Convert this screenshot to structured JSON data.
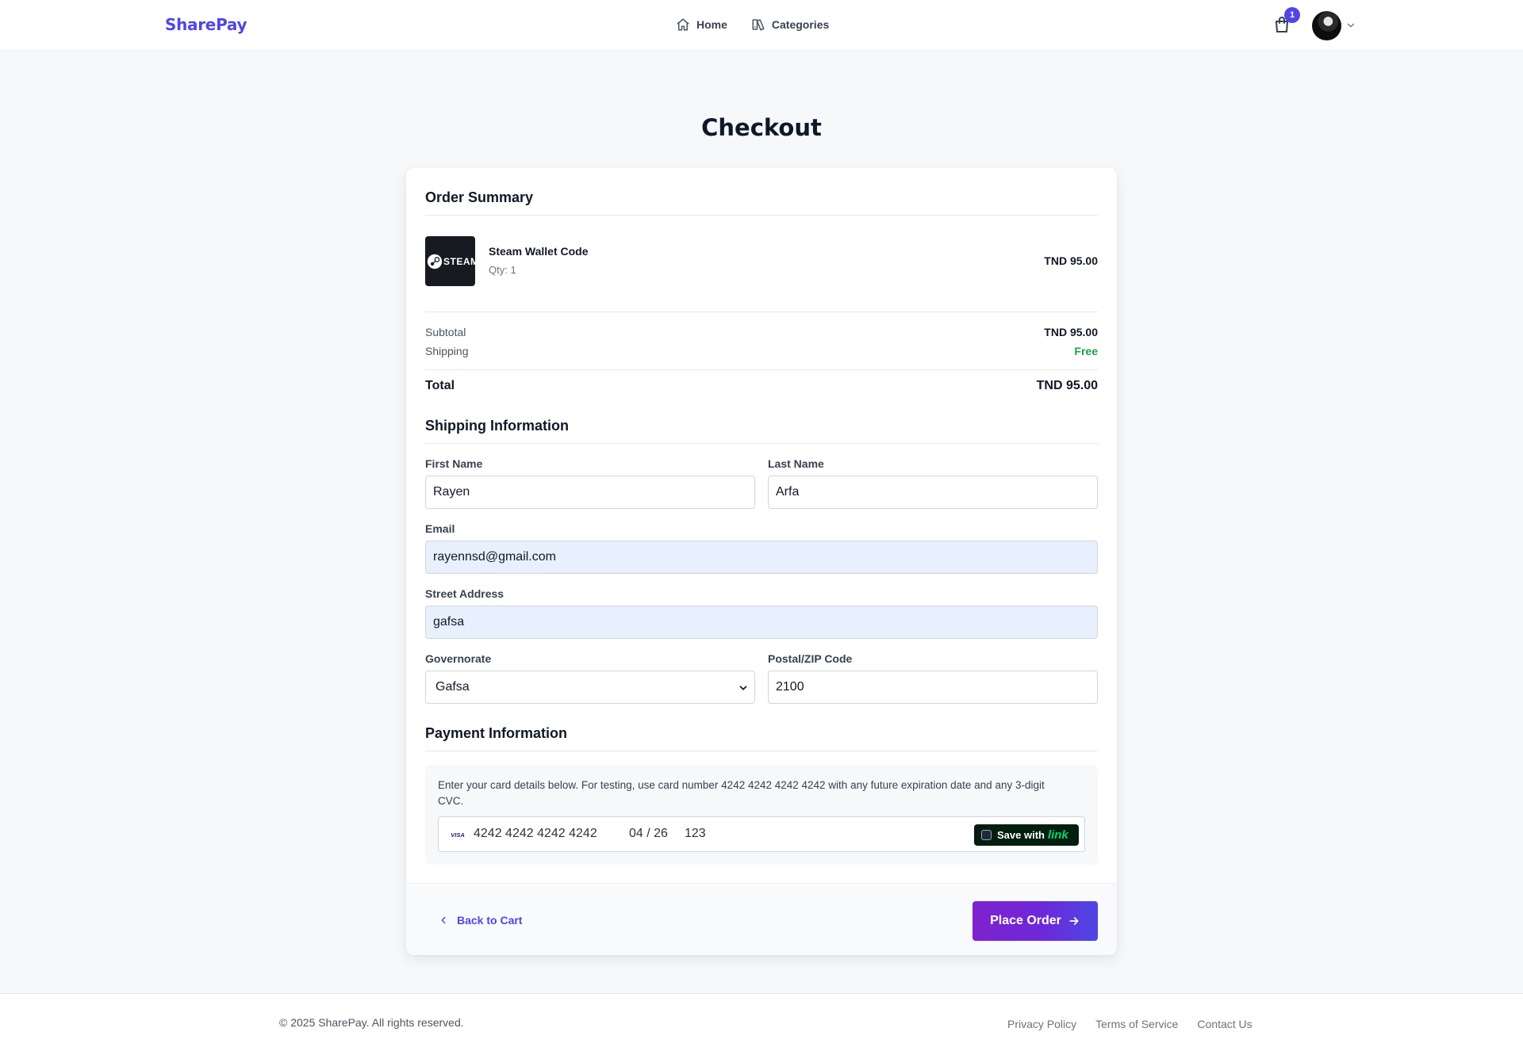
{
  "header": {
    "brand": "SharePay",
    "nav": [
      {
        "label": "Home",
        "icon": "home-icon"
      },
      {
        "label": "Categories",
        "icon": "categories-icon"
      }
    ],
    "cart_count": "1",
    "avatar_icon": "user-avatar"
  },
  "page_title": "Checkout",
  "order_summary": {
    "title": "Order Summary",
    "item": {
      "image_text": "STEAM",
      "name": "Steam Wallet Code",
      "qty": "Qty: 1",
      "price": "TND 95.00"
    },
    "subtotal_label": "Subtotal",
    "subtotal_value": "TND 95.00",
    "shipping_label": "Shipping",
    "shipping_value": "Free",
    "total_label": "Total",
    "total_value": "TND 95.00"
  },
  "shipping": {
    "title": "Shipping Information",
    "first_name_label": "First Name",
    "first_name": "Rayen",
    "last_name_label": "Last Name",
    "last_name": "Arfa",
    "email_label": "Email",
    "email": "rayennsd@gmail.com",
    "address_label": "Street Address",
    "address": "gafsa",
    "governorate_label": "Governorate",
    "governorate": "Gafsa",
    "zip_label": "Postal/ZIP Code",
    "zip": "2100"
  },
  "payment": {
    "title": "Payment Information",
    "note": "Enter your card details below. For testing, use card number 4242 4242 4242 4242 with any future expiration date and any 3-digit CVC.",
    "card_brand": "VISA",
    "card_number": "4242 4242 4242 4242",
    "expiry": "04 / 26",
    "cvc": "123",
    "save_label": "Save with",
    "save_brand": "link"
  },
  "actions": {
    "back": "Back to Cart",
    "place_order": "Place Order"
  },
  "footer": {
    "copyright": "© 2025 SharePay. All rights reserved.",
    "links": [
      "Privacy Policy",
      "Terms of Service",
      "Contact Us"
    ]
  },
  "colors": {
    "accent": "#4f46e5",
    "button_gradient_start": "#7e22ce",
    "button_gradient_end": "#4f46e5",
    "free_green": "#16a34a",
    "autofill_bg": "#e8f0fe",
    "link_brand": "#00d66f"
  }
}
